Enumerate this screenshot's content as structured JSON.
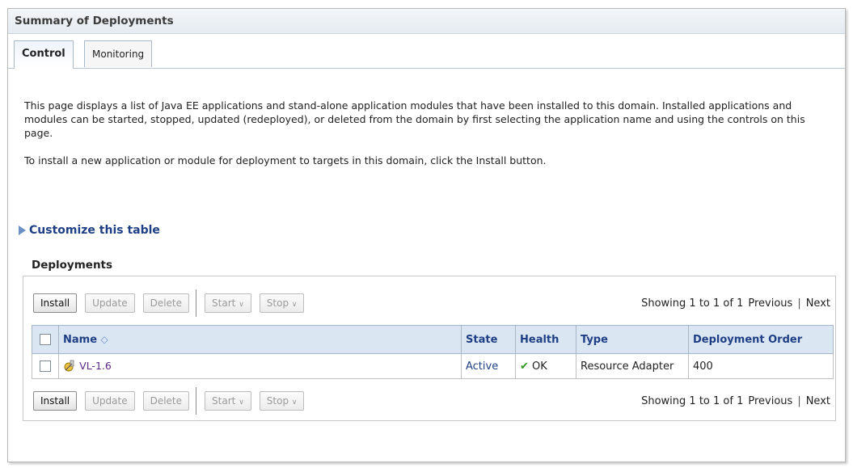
{
  "header": {
    "title": "Summary of Deployments"
  },
  "tabs": [
    {
      "label": "Control",
      "active": true
    },
    {
      "label": "Monitoring",
      "active": false
    }
  ],
  "description": {
    "para1": "This page displays a list of Java EE applications and stand-alone application modules that have been installed to this domain. Installed applications and modules can be started, stopped, updated (redeployed), or deleted from the domain by first selecting the application name and using the controls on this page.",
    "para2": "To install a new application or module for deployment to targets in this domain, click the Install button."
  },
  "customize": {
    "label": "Customize this table"
  },
  "deployments": {
    "label": "Deployments",
    "toolbar": {
      "install": "Install",
      "update": "Update",
      "delete": "Delete",
      "start": "Start",
      "stop": "Stop"
    },
    "pagination": {
      "showing": "Showing 1 to 1 of 1",
      "previous": "Previous",
      "separator": "|",
      "next": "Next"
    },
    "columns": {
      "name": "Name",
      "state": "State",
      "health": "Health",
      "type": "Type",
      "order": "Deployment Order"
    },
    "rows": [
      {
        "name": "VL-1.6",
        "state": "Active",
        "health": "OK",
        "type": "Resource Adapter",
        "order": "400"
      }
    ]
  },
  "colors": {
    "header_link": "#1f3f85",
    "app_link": "#5b2a87",
    "ok_green": "#2e9a1e",
    "table_header_bg": "#dbe6f3"
  },
  "icons": [
    "triangle-right-icon",
    "sort-ascending-icon",
    "dropdown-arrow-icon",
    "application-icon",
    "checkmark-icon"
  ]
}
